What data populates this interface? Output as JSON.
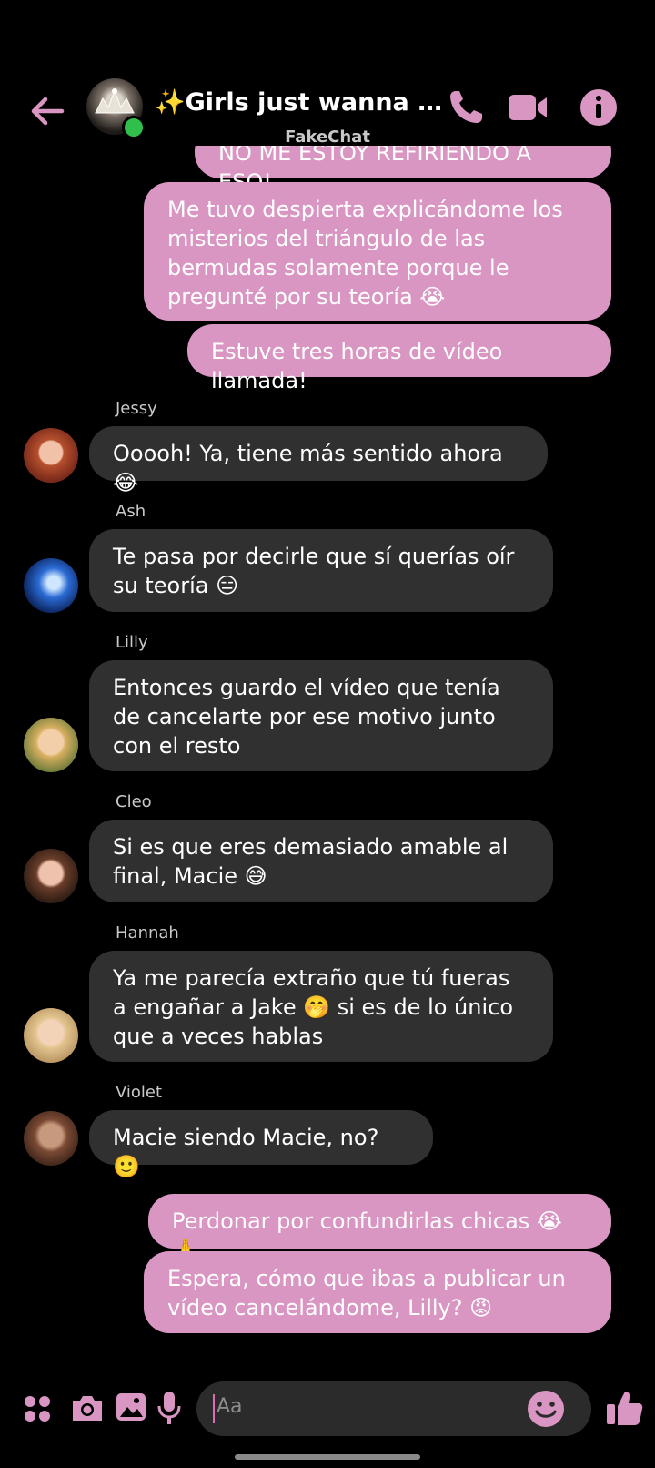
{
  "header": {
    "title": "✨Girls just wanna to h...",
    "watermark": "FakeChat"
  },
  "colors": {
    "accent": "#d996c2",
    "incoming_bubble": "#303030",
    "background": "#000000",
    "online": "#2fbf4a"
  },
  "messages": {
    "m0": "NO ME ESTOY REFIRIENDO A ESO!",
    "m1": "Me tuvo despierta explicándome los misterios del triángulo de las bermudas solamente porque le pregunté por su teoría 😭",
    "m2": "Estuve tres horas de vídeo llamada!",
    "jessy_name": "Jessy",
    "jessy_text": "Ooooh! Ya, tiene más sentido ahora 😂",
    "ash_name": "Ash",
    "ash_text": "Te pasa por decirle que sí querías oír su teoría 😑",
    "lilly_name": "Lilly",
    "lilly_text": "Entonces guardo el vídeo que tenía de cancelarte por ese motivo junto con el resto",
    "cleo_name": "Cleo",
    "cleo_text": "Si es que eres demasiado amable al final, Macie 😅",
    "hannah_name": "Hannah",
    "hannah_text": "Ya me parecía extraño que tú fueras a engañar a Jake 🤭 si es de lo único que a veces hablas",
    "violet_name": "Violet",
    "violet_text": "Macie siendo Macie, no? 🙂",
    "m3": "Perdonar por confundirlas chicas 😭🙏",
    "m4": "Espera, cómo que ibas a publicar un vídeo cancelándome, Lilly? 😡"
  },
  "composer": {
    "placeholder": "Aa"
  },
  "icons": [
    "back-arrow-icon",
    "phone-icon",
    "video-icon",
    "info-icon",
    "apps-icon",
    "camera-icon",
    "gallery-icon",
    "microphone-icon",
    "emoji-icon",
    "thumbs-up-icon"
  ]
}
